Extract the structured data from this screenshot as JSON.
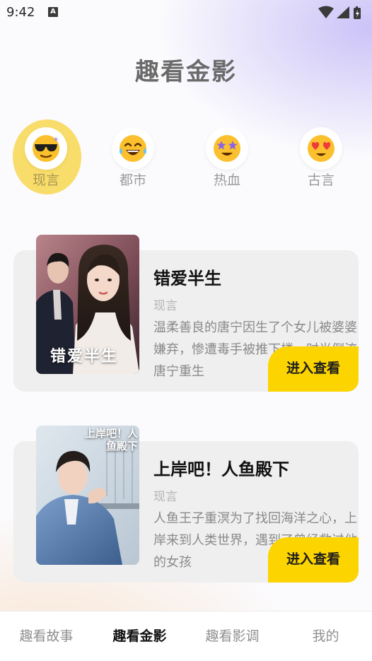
{
  "status": {
    "time": "9:42",
    "notif_glyph": "A"
  },
  "header": {
    "title": "趣看金影"
  },
  "categories": [
    {
      "label": "现言",
      "icon": "cool-sunglasses-emoji-icon",
      "active": true
    },
    {
      "label": "都市",
      "icon": "tears-of-joy-emoji-icon",
      "active": false
    },
    {
      "label": "热血",
      "icon": "star-struck-emoji-icon",
      "active": false
    },
    {
      "label": "古言",
      "icon": "heart-eyes-emoji-icon",
      "active": false
    }
  ],
  "dramas": [
    {
      "title": "错爱半生",
      "genre": "现言",
      "description": "温柔善良的唐宁因生了个女儿被婆婆嫌弃，惨遭毒手被推下楼，时光倒流唐宁重生",
      "cover_text": "错爱半生",
      "button": "进入查看"
    },
    {
      "title": "上岸吧！人鱼殿下",
      "genre": "现言",
      "description": "人鱼王子重溟为了找回海洋之心，上岸来到人类世界，遇到了曾经救过他的女孩",
      "cover_text": "上岸吧！人鱼殿下",
      "button": "进入查看"
    }
  ],
  "nav": {
    "items": [
      "趣看故事",
      "趣看金影",
      "趣看影调",
      "我的"
    ],
    "active": "趣看金影"
  }
}
